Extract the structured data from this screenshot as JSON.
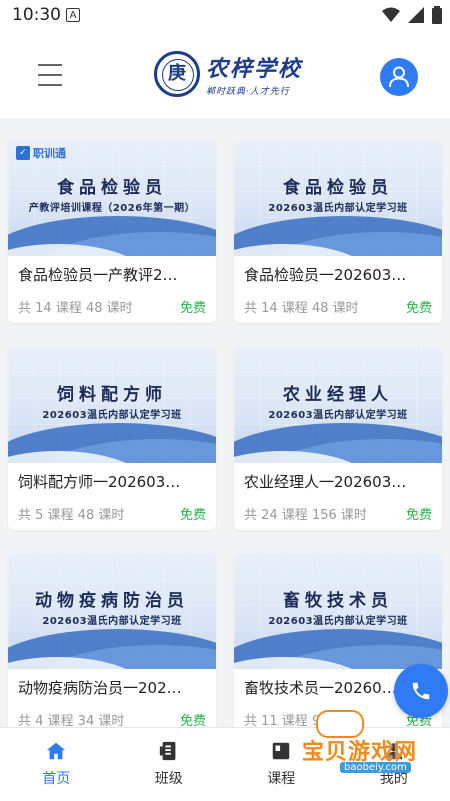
{
  "status_bar": {
    "time": "10:30",
    "notification_letter": "A"
  },
  "header": {
    "logo_name": "农梓学校",
    "logo_slogan": "郸时跃典·人才先行",
    "logo_seal_glyph": "庚"
  },
  "courses": [
    {
      "banner_title": "食品检验员",
      "banner_subtitle": "产教评培训课程（2026年第一期）",
      "brand": "职训通",
      "name": "食品检验员一产教评2…",
      "stats": "共 14 课程 48 课时",
      "price": "免费"
    },
    {
      "banner_title": "食品检验员",
      "banner_subtitle": "202603温氏内部认定学习班",
      "brand": "",
      "name": "食品检验员一202603…",
      "stats": "共 14 课程 48 课时",
      "price": "免费"
    },
    {
      "banner_title": "饲料配方师",
      "banner_subtitle": "202603温氏内部认定学习班",
      "brand": "",
      "name": "饲料配方师一202603…",
      "stats": "共 5 课程 48 课时",
      "price": "免费"
    },
    {
      "banner_title": "农业经理人",
      "banner_subtitle": "202603温氏内部认定学习班",
      "brand": "",
      "name": "农业经理人一202603…",
      "stats": "共 24 课程 156 课时",
      "price": "免费"
    },
    {
      "banner_title": "动物疫病防治员",
      "banner_subtitle": "202603温氏内部认定学习班",
      "brand": "",
      "name": "动物疫病防治员一202…",
      "stats": "共 4 课程 34 课时",
      "price": "免费"
    },
    {
      "banner_title": "畜牧技术员",
      "banner_subtitle": "202603温氏内部认定学习班",
      "brand": "",
      "name": "畜牧技术员一20260…",
      "stats": "共 11 课程 95 课时",
      "price": "免费"
    }
  ],
  "nav": [
    {
      "label": "首页",
      "icon": "home-icon",
      "active": true
    },
    {
      "label": "班级",
      "icon": "class-icon",
      "active": false
    },
    {
      "label": "课程",
      "icon": "course-icon",
      "active": false
    },
    {
      "label": "我的",
      "icon": "profile-icon",
      "active": false
    }
  ],
  "watermark": {
    "text": "宝贝游戏网",
    "url": "baobeiy.com"
  },
  "colors": {
    "accent": "#2f7bf6",
    "free": "#2bb24c",
    "logo": "#1d3c8c"
  }
}
